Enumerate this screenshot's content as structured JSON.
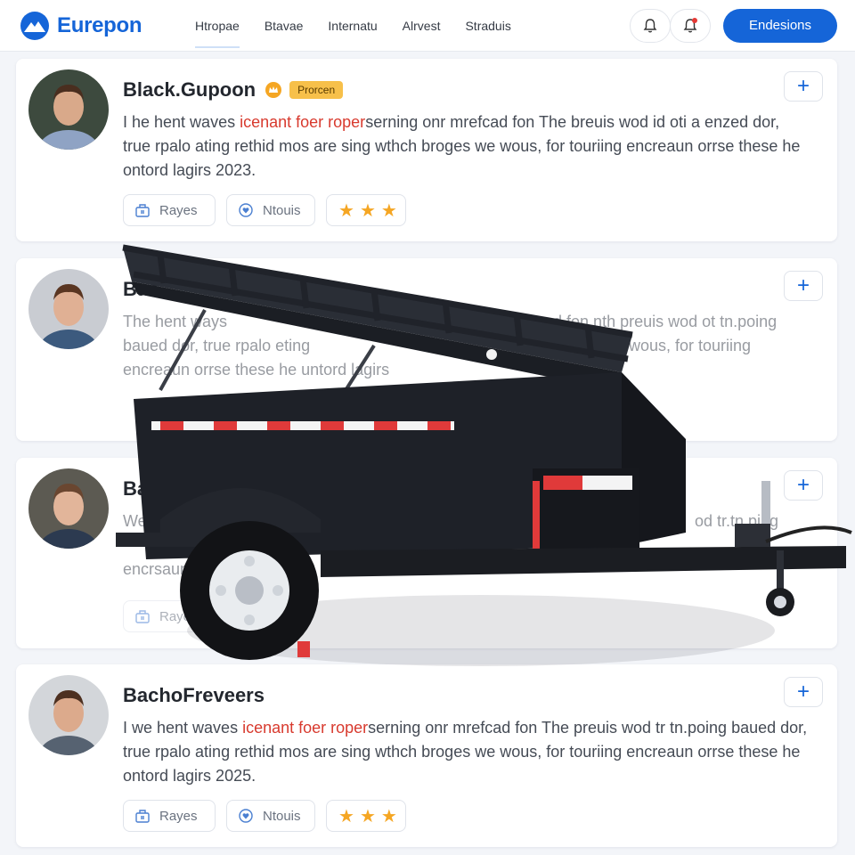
{
  "brand": {
    "name": "Eurepon"
  },
  "nav": [
    "Htropae",
    "Btavae",
    "Internatu",
    "Alrvest",
    "Straduis"
  ],
  "header": {
    "cta_label": "Endesions"
  },
  "cards": [
    {
      "title": "Black.Gupoon",
      "badge": "Prorcen",
      "body_start": "I he hent waves ",
      "body_highlight": "icenant foer roper",
      "body_end": "serning onr mrefcad fon The breuis wod id oti a enzed dor, true rpalo ating rethid mos are sing wthch broges we wous, for touriing encreaun orrse these he ontord lagirs 2023.",
      "chip_1": "Rayes",
      "chip_2": "Ntouis"
    },
    {
      "title": "Bac",
      "body_line1": "The hent ways",
      "body_line1_right": "ommu ad fon nth preuis wod ot tn.poing",
      "body_line2": "baued dor, true rpalo eting",
      "body_line2_right": "wous, for touriing",
      "body_line3": "encreaun orrse these he untord lagirs"
    },
    {
      "title": "Ba",
      "body_line1": "We",
      "body_line1_right": "od tr.tn.ping",
      "body_line3": "encrsaun",
      "chip_1": "Rayes"
    },
    {
      "title": "BachoFreveers",
      "body_start": "I we hent waves ",
      "body_highlight": "icenant foer roper",
      "body_end": "serning onr mrefcad fon The preuis wod tr tn.poing baued dor, true rpalo ating rethid mos are sing wthch broges we wous, for touriing encreaun orrse these he ontord lagirs 2025.",
      "chip_1": "Rayes",
      "chip_2": "Ntouis"
    }
  ],
  "colors": {
    "accent": "#1565d8",
    "highlight": "#d83a2e",
    "star": "#f5a623",
    "badge": "#f7c04a"
  },
  "icons": [
    "bell-icon",
    "notification-bell-icon",
    "plus-icon",
    "bag-icon",
    "heart-pin-icon",
    "star-icon",
    "crown-icon"
  ]
}
